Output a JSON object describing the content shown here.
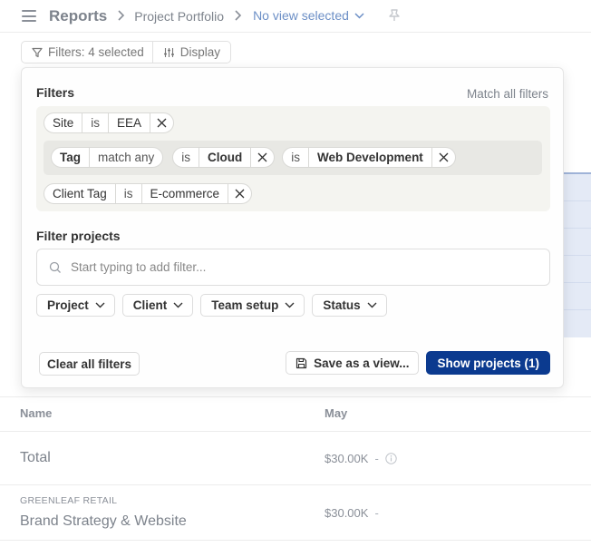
{
  "header": {
    "title": "Reports",
    "breadcrumb_page": "Project Portfolio",
    "view_selector": "No view selected"
  },
  "toolbar": {
    "filters_label": "Filters: 4 selected",
    "display_label": "Display"
  },
  "popover": {
    "title": "Filters",
    "match_all": "Match all filters",
    "site_filter": {
      "key": "Site",
      "op": "is",
      "value": "EEA"
    },
    "tag_filter": {
      "key": "Tag",
      "mode": "match any",
      "items": [
        {
          "op": "is",
          "value": "Cloud"
        },
        {
          "op": "is",
          "value": "Web Development"
        }
      ]
    },
    "client_tag_filter": {
      "key": "Client Tag",
      "op": "is",
      "value": "E-commerce"
    },
    "filter_projects_label": "Filter projects",
    "search_placeholder": "Start typing to add filter...",
    "dropdowns": [
      "Project",
      "Client",
      "Team setup",
      "Status"
    ],
    "clear_label": "Clear all filters",
    "save_label": "Save as a view...",
    "show_label": "Show projects (1)"
  },
  "table": {
    "columns": [
      "Name",
      "May"
    ],
    "total": {
      "label": "Total",
      "value": "$30.00K",
      "dash": "-"
    },
    "rows": [
      {
        "client": "GREENLEAF RETAIL",
        "project": "Brand Strategy & Website",
        "value": "$30.00K",
        "dash": "-"
      }
    ]
  },
  "colors": {
    "accent": "#0b3a8f",
    "link": "#6c8fc6",
    "filter_box": "#f4f4f0"
  }
}
